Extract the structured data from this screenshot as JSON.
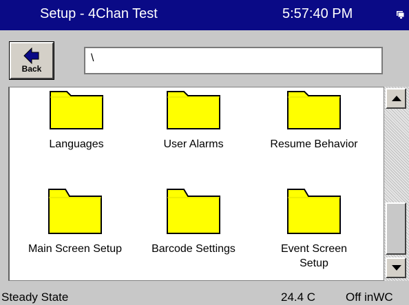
{
  "titlebar": {
    "title": "Setup - 4Chan Test",
    "clock": "5:57:40 PM"
  },
  "toolbar": {
    "back_label": "Back",
    "path_value": "\\"
  },
  "folders": [
    {
      "label": "Languages"
    },
    {
      "label": "User Alarms"
    },
    {
      "label": "Resume Behavior"
    },
    {
      "label": "Main Screen Setup"
    },
    {
      "label": "Barcode Settings"
    },
    {
      "label": "Event Screen Setup"
    }
  ],
  "statusbar": {
    "state": "Steady State",
    "temperature": "24.4 C",
    "pressure": "Off inWC"
  },
  "colors": {
    "titlebar": "#0a0a86",
    "folder_fill": "#ffff00",
    "folder_outline": "#000000"
  },
  "icons": {
    "back": "left-arrow-icon",
    "folder": "folder-icon",
    "scroll_up": "scroll-up-arrow-icon",
    "scroll_down": "scroll-down-arrow-icon",
    "tray": "network-tray-icon"
  }
}
